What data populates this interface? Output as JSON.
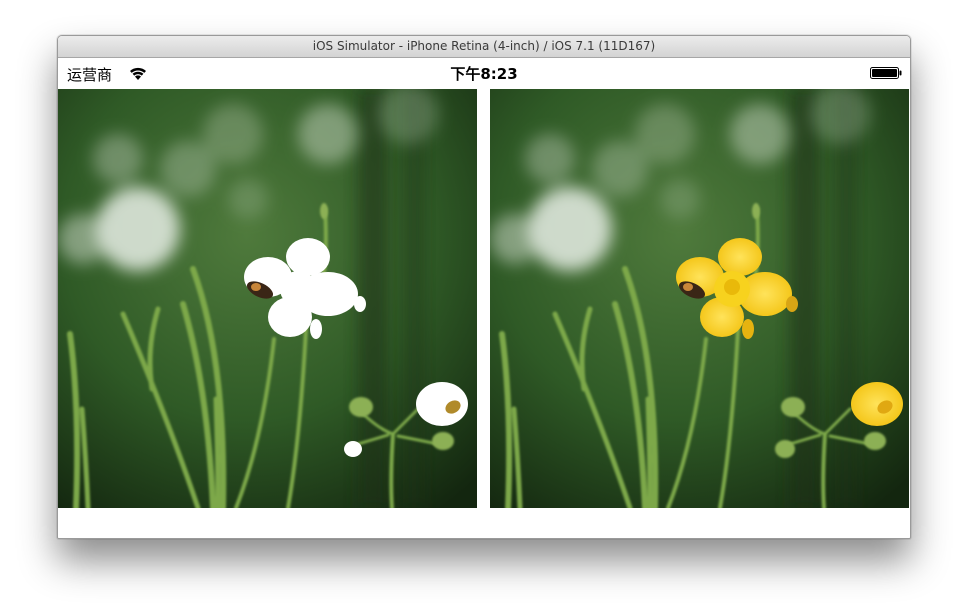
{
  "window": {
    "title": "iOS Simulator - iPhone Retina (4-inch) / iOS 7.1 (11D167)"
  },
  "statusbar": {
    "carrier": "运营商",
    "time": "下午8:23",
    "signal_icon": "wifi-icon",
    "battery_icon": "battery-icon"
  },
  "photos": [
    {
      "description_name": "filtered-flower-photo",
      "flower_color": "#ffffff"
    },
    {
      "description_name": "original-flower-photo",
      "flower_color": "#f5cf1a"
    }
  ],
  "colors": {
    "background_green": "#2f5a26",
    "stem_green": "#7da84a",
    "bokeh": "#e8eee6"
  }
}
